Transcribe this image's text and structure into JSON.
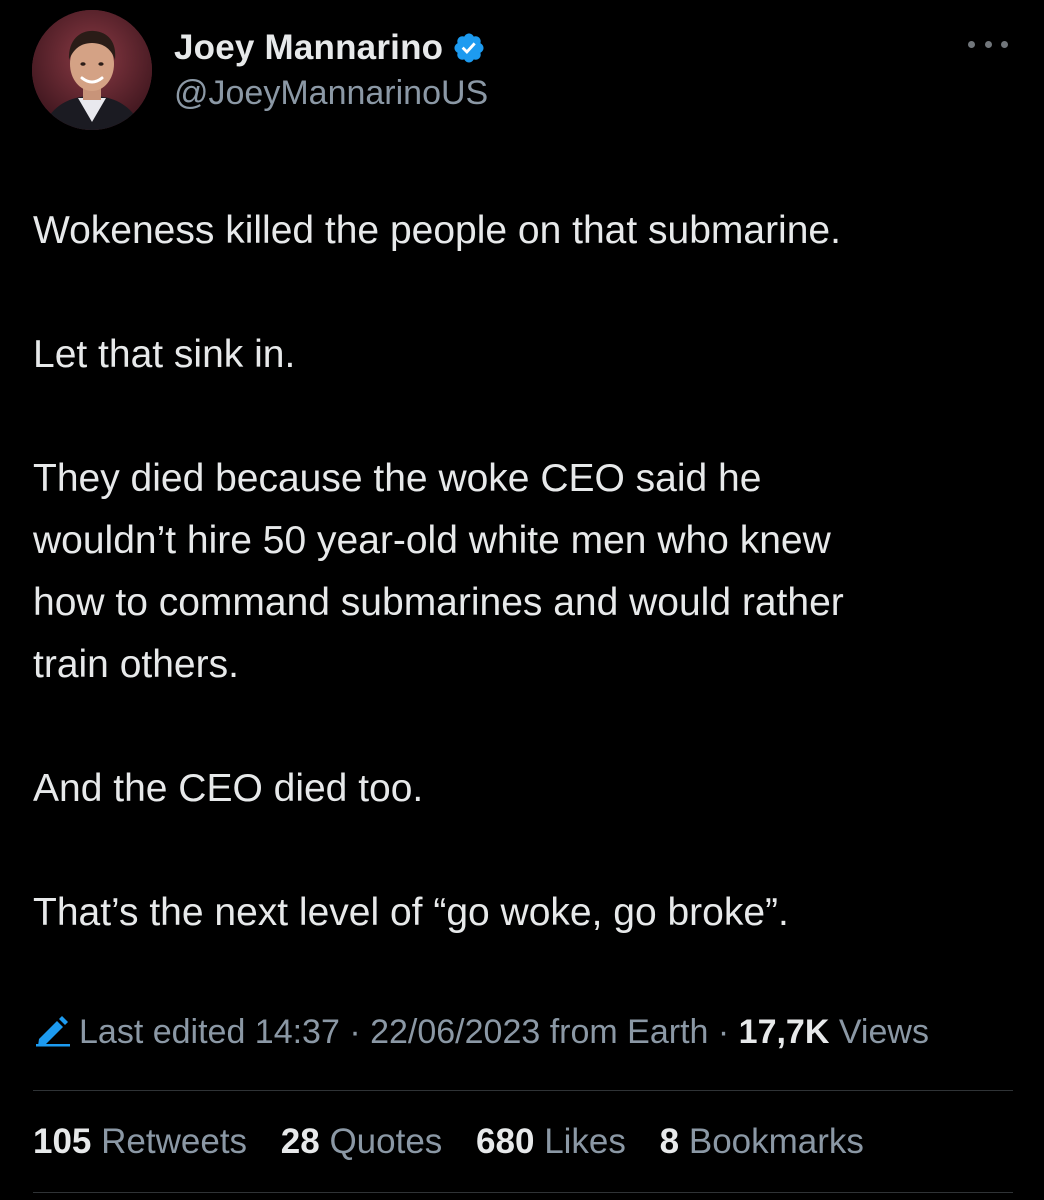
{
  "author": {
    "display_name": "Joey Mannarino",
    "handle": "@JoeyMannarinoUS",
    "verified": true,
    "avatar_icon": "profile-photo",
    "verified_icon": "verified-badge-icon"
  },
  "menu": {
    "icon": "more-horizontal-icon"
  },
  "tweet": {
    "paragraphs": [
      "Wokeness killed the people on that submarine.",
      "Let that sink in.",
      "They died because the woke CEO said he\nwouldn’t hire 50 year-old white men who knew\nhow to command submarines and would rather\ntrain others.",
      "And the CEO died too.",
      "That’s the next level of “go woke, go broke”."
    ]
  },
  "meta": {
    "edit_icon": "pencil-edit-icon",
    "edited_label": "Last edited 14:37 · 22/06/2023",
    "source": "from Earth",
    "separator": "·",
    "views_count": "17,7K",
    "views_label": "Views"
  },
  "stats": [
    {
      "count": "105",
      "label": "Retweets"
    },
    {
      "count": "28",
      "label": "Quotes"
    },
    {
      "count": "680",
      "label": "Likes"
    },
    {
      "count": "8",
      "label": "Bookmarks"
    }
  ],
  "colors": {
    "background": "#000000",
    "text_primary": "#e7e9ea",
    "text_secondary": "#8b98a5",
    "verified_blue": "#1d9bf0",
    "divider": "#2f3336"
  }
}
